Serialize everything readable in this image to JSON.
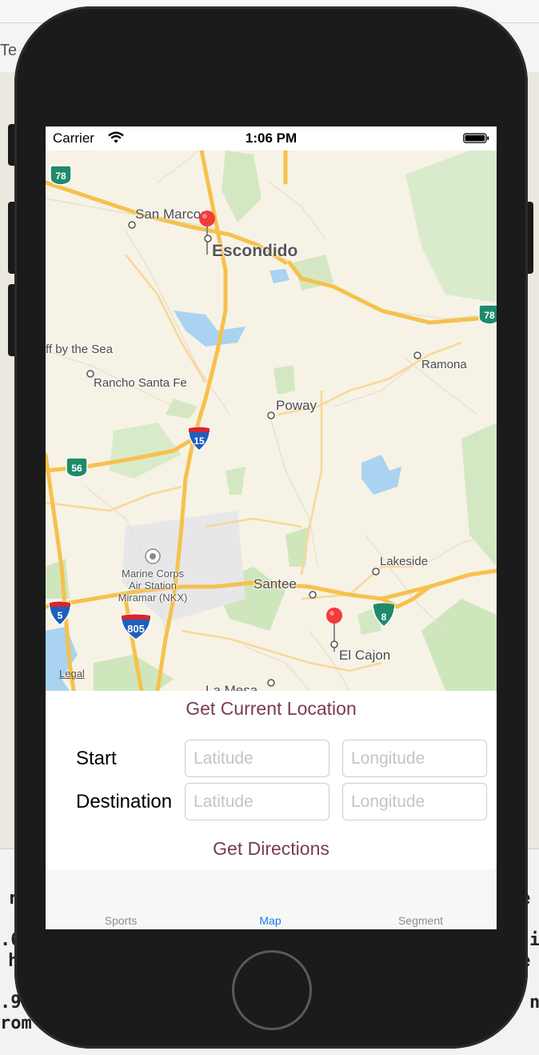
{
  "background": {
    "tab_title": "Te",
    "code_fragments": [
      "r",
      "e",
      ".6",
      "i",
      "h",
      "e",
      ".9",
      "n",
      "rom"
    ]
  },
  "status_bar": {
    "carrier": "Carrier",
    "time": "1:06 PM"
  },
  "map": {
    "labels": {
      "san_marcos": "San Marcos",
      "escondido": "Escondido",
      "del_mar": "ff by the Sea",
      "rancho_santa_fe": "Rancho Santa Fe",
      "poway": "Poway",
      "ramona": "Ramona",
      "lakeside": "Lakeside",
      "santee": "Santee",
      "el_cajon": "El Cajon",
      "la_mesa": "La Mesa",
      "miramar": "Marine Corps\nAir Station\nMiramar (NKX)"
    },
    "shields": {
      "sr78_left": "78",
      "sr78_right": "78",
      "i15": "15",
      "sr56": "56",
      "i5": "5",
      "i805": "805",
      "i8": "8"
    },
    "legal": "Legal",
    "colors": {
      "land": "#f7f2e6",
      "park": "#cfe6bd",
      "water": "#a9d3f0",
      "highway": "#f6c14c",
      "pin": "#f23b3b"
    }
  },
  "controls": {
    "get_location": "Get Current Location",
    "start_label": "Start",
    "destination_label": "Destination",
    "latitude_placeholder": "Latitude",
    "longitude_placeholder": "Longitude",
    "get_directions": "Get Directions"
  },
  "tab_bar": {
    "items": [
      {
        "label": "Sports",
        "active": false
      },
      {
        "label": "Map",
        "active": true
      },
      {
        "label": "Segment",
        "active": false
      }
    ]
  }
}
